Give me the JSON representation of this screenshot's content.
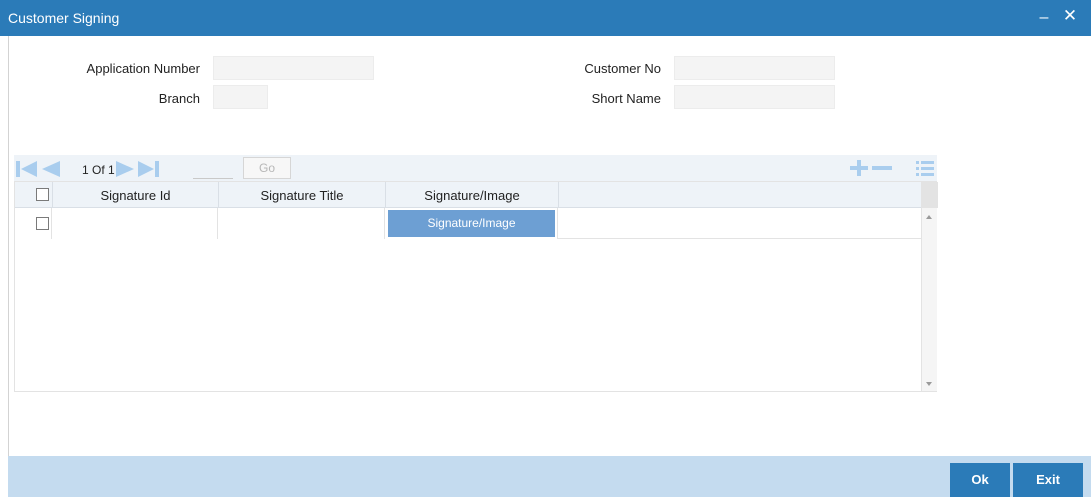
{
  "window": {
    "title": "Customer Signing",
    "minimize_glyph": "–",
    "close_glyph": "✕"
  },
  "form": {
    "application_number": {
      "label": "Application Number",
      "value": ""
    },
    "branch": {
      "label": "Branch",
      "value": ""
    },
    "customer_no": {
      "label": "Customer No",
      "value": ""
    },
    "short_name": {
      "label": "Short Name",
      "value": ""
    }
  },
  "pagination": {
    "current_page": "1",
    "of_label": "Of",
    "total_pages": "1",
    "page_text": "1 Of 1",
    "go_label": "Go"
  },
  "grid": {
    "columns": [
      "Signature Id",
      "Signature Title",
      "Signature/Image"
    ],
    "rows": [
      {
        "signature_id": "",
        "signature_title": "",
        "signature_image_button": "Signature/Image"
      }
    ]
  },
  "footer": {
    "ok_label": "Ok",
    "exit_label": "Exit"
  },
  "colors": {
    "titlebar": "#2b7bb8",
    "footer": "#c4dbef",
    "grid_header": "#eef3f8",
    "toolbar_icon": "#a9cdee",
    "signature_button": "#6d9fd3"
  },
  "icons": [
    "first-page-icon",
    "prev-page-icon",
    "next-page-icon",
    "last-page-icon",
    "add-row-icon",
    "remove-row-icon",
    "single-record-view-icon",
    "minimize-icon",
    "close-icon"
  ]
}
